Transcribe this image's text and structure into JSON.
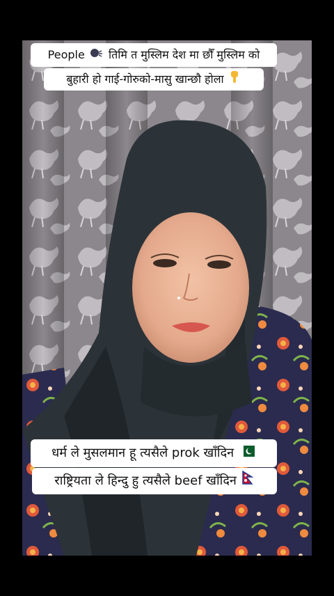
{
  "captions": {
    "top_line_1_prefix": "People",
    "top_line_1_icon": "speaking-head-icon",
    "top_line_1_text": "तिमि त मुस्लिम देश मा छौँ मुस्लिम को",
    "top_line_2_text": "बुहारी हो गाई-गोरुको-मासु खान्छौ होला",
    "top_line_2_icon": "pointing-down-hand-icon",
    "bottom_line_1_text": "धर्म ले मुसलमान हू त्यसैले prok खाँदिन",
    "bottom_line_1_icon": "pakistan-flag-icon",
    "bottom_line_2_text": "राष्ट्रियता ले हिन्दु हु त्यसैले beef खाँदिन",
    "bottom_line_2_icon": "nepal-flag-icon"
  },
  "colors": {
    "background": "#000000",
    "caption_bg": "#ffffff",
    "caption_text": "#111111",
    "hijab": "#2c3338",
    "curtain": "#8d8a8d",
    "dress": "#2a2b4e"
  }
}
